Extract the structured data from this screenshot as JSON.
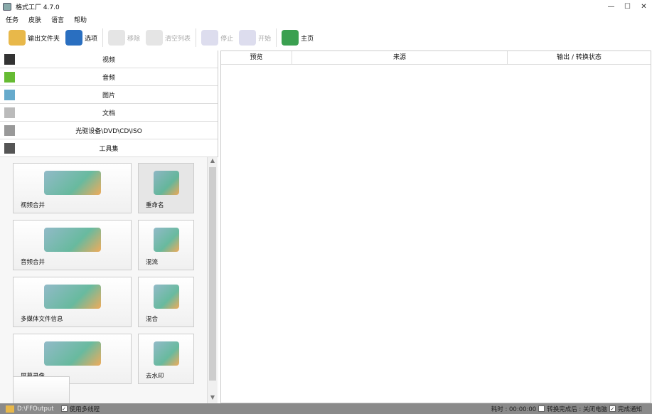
{
  "window": {
    "title": "格式工厂 4.7.0",
    "min": "—",
    "max": "☐",
    "close": "✕"
  },
  "menu": [
    "任务",
    "皮肤",
    "语言",
    "帮助"
  ],
  "toolbar": [
    {
      "label": "输出文件夹",
      "icon": "folder-icon",
      "enabled": true,
      "color": "#e8b84a"
    },
    {
      "label": "选项",
      "icon": "gear-icon",
      "enabled": true,
      "color": "#2a6fc0"
    },
    {
      "label": "移除",
      "icon": "remove-icon",
      "enabled": false,
      "color": "#e5e5e5"
    },
    {
      "label": "清空列表",
      "icon": "clear-list-icon",
      "enabled": false,
      "color": "#e5e5e5"
    },
    {
      "label": "停止",
      "icon": "stop-icon",
      "enabled": false,
      "color": "#dde"
    },
    {
      "label": "开始",
      "icon": "start-icon",
      "enabled": false,
      "color": "#dde"
    },
    {
      "label": "主页",
      "icon": "globe-icon",
      "enabled": true,
      "color": "#3aa050"
    }
  ],
  "categories": [
    {
      "label": "视频",
      "icon": "video-icon",
      "color": "#333"
    },
    {
      "label": "音频",
      "icon": "audio-icon",
      "color": "#6b3"
    },
    {
      "label": "图片",
      "icon": "picture-icon",
      "color": "#6ac"
    },
    {
      "label": "文档",
      "icon": "document-icon",
      "color": "#bbb"
    },
    {
      "label": "光驱设备\\DVD\\CD\\ISO",
      "icon": "disc-drive-icon",
      "color": "#999"
    },
    {
      "label": "工具集",
      "icon": "tools-icon",
      "color": "#555"
    }
  ],
  "tools": [
    {
      "label": "视频合并",
      "icon": "video-merge-icon"
    },
    {
      "label": "重命名",
      "icon": "rename-icon"
    },
    {
      "label": "音频合并",
      "icon": "audio-merge-icon"
    },
    {
      "label": "混流",
      "icon": "mux-icon"
    },
    {
      "label": "多媒体文件信息",
      "icon": "media-info-icon"
    },
    {
      "label": "混合",
      "icon": "mix-icon"
    },
    {
      "label": "屏幕录像",
      "icon": "screen-record-icon"
    },
    {
      "label": "去水印",
      "icon": "remove-watermark-icon"
    }
  ],
  "table": {
    "columns": [
      "预览",
      "来源",
      "输出 / 转换状态"
    ]
  },
  "status": {
    "output_path": "D:\\FFOutput",
    "multithread": "使用多线程",
    "elapsed": "耗时 : 00:00:00",
    "after_convert": "转换完成后 : 关闭电脑",
    "notify": "完成通知"
  }
}
